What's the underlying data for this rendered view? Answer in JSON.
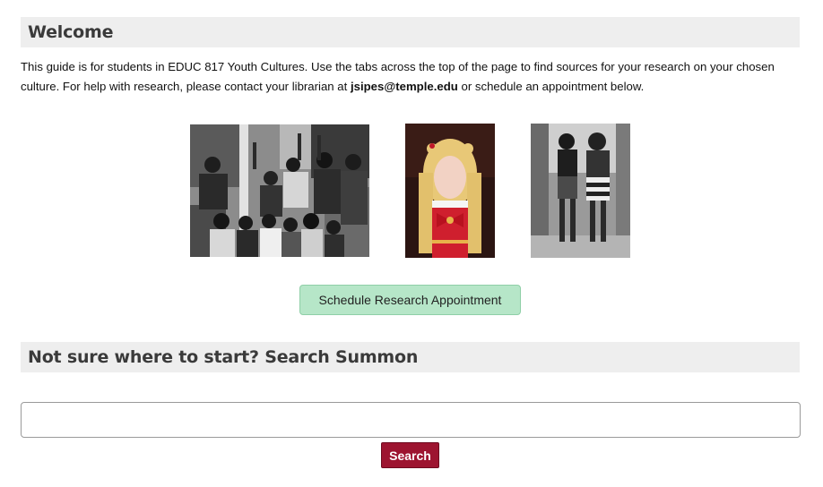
{
  "welcome": {
    "title": "Welcome",
    "intro_part1": "This guide is for students in EDUC 817 Youth Cultures. Use the tabs across the top of the page to find sources for your research on your chosen culture. For help with research, please contact your librarian at ",
    "email": "jsipes@temple.edu",
    "intro_part2": " or schedule an appointment below."
  },
  "photos": [
    {
      "subject": "black-and-white protest group photo"
    },
    {
      "subject": "cosplayer in red sailor costume with blonde pigtails"
    },
    {
      "subject": "black-and-white two girls walking"
    }
  ],
  "appointment": {
    "button_label": "Schedule Research Appointment"
  },
  "summon": {
    "title": "Not sure where to start? Search Summon",
    "search_value": "",
    "search_button_label": "Search"
  },
  "colors": {
    "header_bg": "#eeeeee",
    "appointment_button_bg": "#b6e6c8",
    "search_button_bg": "#9d1430"
  }
}
